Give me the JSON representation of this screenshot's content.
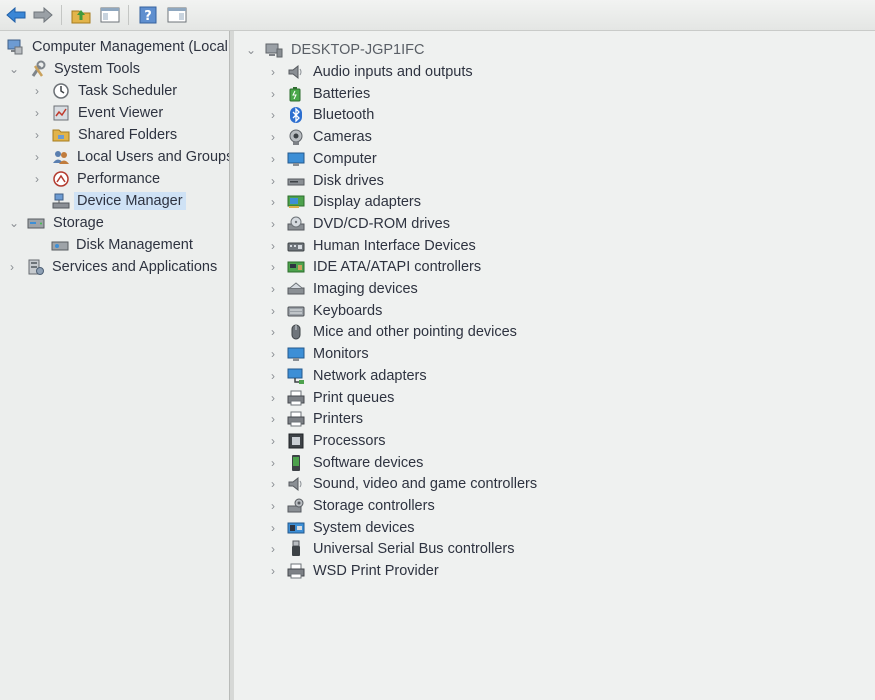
{
  "toolbar": {
    "buttons": [
      {
        "name": "back-button",
        "icon": "back-arrow-icon"
      },
      {
        "name": "forward-button",
        "icon": "forward-arrow-icon"
      },
      {
        "name": "up-one-level-button",
        "icon": "folder-up-icon"
      },
      {
        "name": "show-hide-console-tree-button",
        "icon": "console-tree-icon"
      },
      {
        "name": "help-button",
        "icon": "help-icon"
      },
      {
        "name": "show-hide-action-pane-button",
        "icon": "action-pane-icon"
      }
    ]
  },
  "left_tree": {
    "root": "Computer Management (Local",
    "system_tools": "System Tools",
    "task_scheduler": "Task Scheduler",
    "event_viewer": "Event Viewer",
    "shared_folders": "Shared Folders",
    "local_users_groups": "Local Users and Groups",
    "performance": "Performance",
    "device_manager": "Device Manager",
    "storage": "Storage",
    "disk_management": "Disk Management",
    "services_applications": "Services and Applications"
  },
  "device_tree": {
    "computer_name": "DESKTOP-JGP1IFC",
    "categories": [
      {
        "label": "Audio inputs and outputs",
        "icon": "speaker-icon"
      },
      {
        "label": "Batteries",
        "icon": "battery-icon"
      },
      {
        "label": "Bluetooth",
        "icon": "bluetooth-icon"
      },
      {
        "label": "Cameras",
        "icon": "camera-icon"
      },
      {
        "label": "Computer",
        "icon": "monitor-icon"
      },
      {
        "label": "Disk drives",
        "icon": "disk-drive-icon"
      },
      {
        "label": "Display adapters",
        "icon": "display-adapter-icon"
      },
      {
        "label": "DVD/CD-ROM drives",
        "icon": "dvd-drive-icon"
      },
      {
        "label": "Human Interface Devices",
        "icon": "hid-icon"
      },
      {
        "label": "IDE ATA/ATAPI controllers",
        "icon": "ide-controller-icon"
      },
      {
        "label": "Imaging devices",
        "icon": "scanner-icon"
      },
      {
        "label": "Keyboards",
        "icon": "keyboard-icon"
      },
      {
        "label": "Mice and other pointing devices",
        "icon": "mouse-icon"
      },
      {
        "label": "Monitors",
        "icon": "monitor-icon"
      },
      {
        "label": "Network adapters",
        "icon": "network-adapter-icon"
      },
      {
        "label": "Print queues",
        "icon": "printer-icon"
      },
      {
        "label": "Printers",
        "icon": "printer-icon"
      },
      {
        "label": "Processors",
        "icon": "processor-icon"
      },
      {
        "label": "Software devices",
        "icon": "software-device-icon"
      },
      {
        "label": "Sound, video and game controllers",
        "icon": "speaker-icon"
      },
      {
        "label": "Storage controllers",
        "icon": "storage-controller-icon"
      },
      {
        "label": "System devices",
        "icon": "system-devices-icon"
      },
      {
        "label": "Universal Serial Bus controllers",
        "icon": "usb-icon"
      },
      {
        "label": "WSD Print Provider",
        "icon": "printer-icon"
      }
    ]
  },
  "colors": {
    "selection": "#cfe2f5",
    "accent_blue": "#2d7fd0",
    "background": "#eff1f0"
  }
}
